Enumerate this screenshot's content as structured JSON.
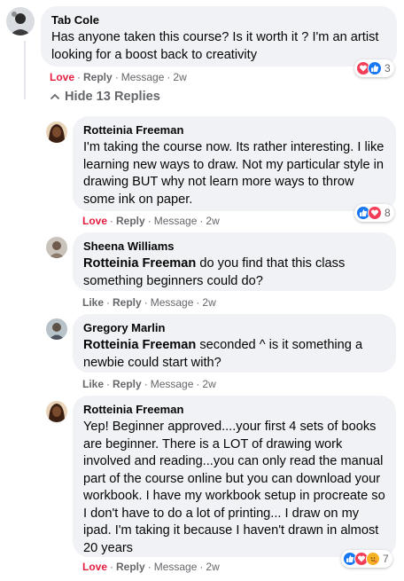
{
  "comments": [
    {
      "author": "Tab Cole",
      "text": "Has anyone taken this course? Is it worth it ? I'm an artist looking for a boost back to creativity",
      "love": "Love",
      "reply": "Reply",
      "message": "Message",
      "time": "2w",
      "reactions": [
        "love",
        "like"
      ],
      "reaction_count": "3"
    },
    {
      "author": "Rotteinia Freeman",
      "text": "I'm taking the course now. Its rather interesting. I like learning new ways to draw. Not my particular style in drawing BUT why not learn more ways to throw some ink on paper.",
      "love": "Love",
      "reply": "Reply",
      "message": "Message",
      "time": "2w",
      "reactions": [
        "like",
        "love"
      ],
      "reaction_count": "8"
    },
    {
      "author": "Sheena Williams",
      "mention": "Rotteinia Freeman",
      "text": " do you find that this class something beginners could do?",
      "like": "Like",
      "reply": "Reply",
      "message": "Message",
      "time": "2w"
    },
    {
      "author": "Gregory Marlin",
      "mention": "Rotteinia Freeman",
      "text": " seconded ^ is it something a newbie could start with?",
      "like": "Like",
      "reply": "Reply",
      "message": "Message",
      "time": "2w"
    },
    {
      "author": "Rotteinia Freeman",
      "text": "Yep! Beginner approved....your first 4 sets of books are beginner. There is a LOT of drawing work involved and reading...you can only read the manual part of the course online but you can download your workbook. I have my workbook setup in procreate so I don't have to do a lot of printing... I draw on my ipad. I'm taking it because I haven't drawn in almost 20 years",
      "love": "Love",
      "reply": "Reply",
      "message": "Message",
      "time": "2w",
      "reactions": [
        "like",
        "love",
        "care"
      ],
      "reaction_count": "7"
    }
  ],
  "hide_replies": "Hide 13 Replies",
  "separator": "·",
  "colors": {
    "bubble": "#f0f2f5",
    "meta": "#65676b",
    "love": "#e41e3f",
    "like_blue": "#1877f2",
    "heart_red": "#f33e58"
  }
}
